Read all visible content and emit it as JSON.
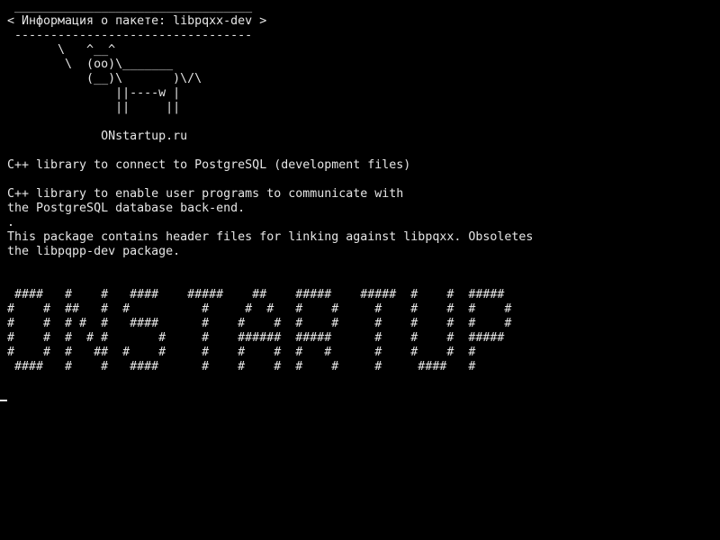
{
  "terminal": {
    "banner_top": " _________________________________",
    "title": "< Информация о пакете: libpqxx-dev >",
    "banner_bottom": " ---------------------------------",
    "cow": [
      "       \\   ^__^",
      "        \\  (oo)\\_______",
      "           (__)\\       )\\/\\",
      "               ||----w |",
      "               ||     ||"
    ],
    "site": "             ONstartup.ru",
    "summary": "C++ library to connect to PostgreSQL (development files)",
    "description": [
      "C++ library to enable user programs to communicate with",
      "the PostgreSQL database back-end.",
      ".",
      "This package contains header files for linking against libpqxx. Obsoletes",
      "the libpqpp-dev package."
    ],
    "big_text": [
      " ####   #    #   ####    #####    ##    #####    #####  #    #  #####",
      "#    #  ##   #  #          #     #  #   #    #     #    #    #  #    #",
      "#    #  # #  #   ####      #    #    #  #    #     #    #    #  #    #",
      "#    #  #  # #       #     #    ######  #####      #    #    #  #####",
      "#    #  #   ##  #    #     #    #    #  #   #      #    #    #  #",
      " ####   #    #   ####      #    #    #  #    #     #     ####   #"
    ]
  }
}
